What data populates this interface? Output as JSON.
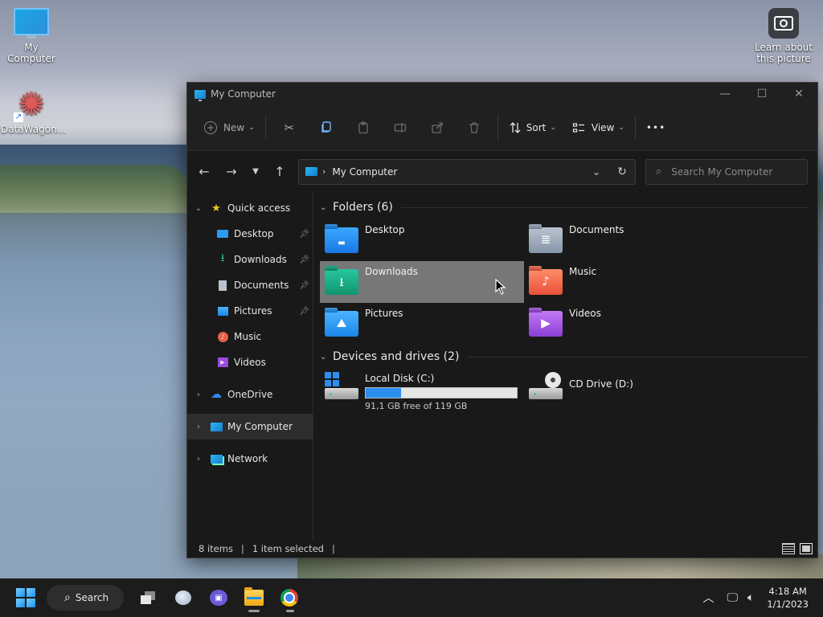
{
  "desktop": {
    "icons": [
      {
        "label": "My Computer"
      },
      {
        "label": "DataWagon..."
      }
    ],
    "learn": {
      "label_line1": "Learn about",
      "label_line2": "this picture"
    }
  },
  "window": {
    "title": "My Computer",
    "controls": {
      "minimize": "—",
      "maximize": "☐",
      "close": "✕"
    }
  },
  "commandbar": {
    "new_label": "New",
    "sort_label": "Sort",
    "view_label": "View",
    "more_label": "•••"
  },
  "nav": {
    "breadcrumb": "My Computer",
    "search_placeholder": "Search My Computer"
  },
  "sidebar": {
    "quick_access": "Quick access",
    "items": [
      {
        "label": "Desktop"
      },
      {
        "label": "Downloads"
      },
      {
        "label": "Documents"
      },
      {
        "label": "Pictures"
      },
      {
        "label": "Music"
      },
      {
        "label": "Videos"
      }
    ],
    "onedrive": "OneDrive",
    "my_computer": "My Computer",
    "network": "Network"
  },
  "content": {
    "folders_header": "Folders (6)",
    "folders": [
      {
        "name": "Desktop"
      },
      {
        "name": "Documents"
      },
      {
        "name": "Downloads"
      },
      {
        "name": "Music"
      },
      {
        "name": "Pictures"
      },
      {
        "name": "Videos"
      }
    ],
    "drives_header": "Devices and drives (2)",
    "drives": [
      {
        "name": "Local Disk (C:)",
        "free_text": "91,1 GB free of 119 GB",
        "used_fraction": 0.234
      },
      {
        "name": "CD Drive (D:)"
      }
    ]
  },
  "status": {
    "items_count": "8 items",
    "selected": "1 item selected"
  },
  "taskbar": {
    "search_label": "Search",
    "time": "4:18 AM",
    "date": "1/1/2023"
  },
  "colors": {
    "accent": "#2a8ff0",
    "window_bg": "#191919",
    "selection": "#777777"
  }
}
